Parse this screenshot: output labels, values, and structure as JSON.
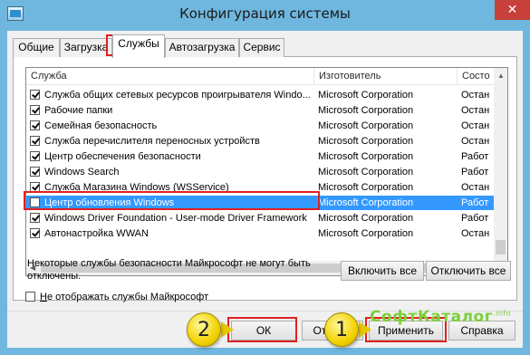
{
  "window": {
    "title": "Конфигурация системы",
    "close_label": "✕"
  },
  "tabs": [
    {
      "label": "Общие"
    },
    {
      "label": "Загрузка"
    },
    {
      "label": "Службы"
    },
    {
      "label": "Автозагрузка"
    },
    {
      "label": "Сервис"
    }
  ],
  "list": {
    "columns": [
      "Служба",
      "Изготовитель",
      "Состо"
    ],
    "rows": [
      {
        "name": "Служба общих сетевых ресурсов проигрывателя Windo...",
        "maker": "Microsoft Corporation",
        "state": "Остан",
        "checked": true
      },
      {
        "name": "Рабочие папки",
        "maker": "Microsoft Corporation",
        "state": "Остан",
        "checked": true
      },
      {
        "name": "Семейная безопасность",
        "maker": "Microsoft Corporation",
        "state": "Остан",
        "checked": true
      },
      {
        "name": "Служба перечислителя переносных устройств",
        "maker": "Microsoft Corporation",
        "state": "Остан",
        "checked": true
      },
      {
        "name": "Центр обеспечения безопасности",
        "maker": "Microsoft Corporation",
        "state": "Работ",
        "checked": true
      },
      {
        "name": "Windows Search",
        "maker": "Microsoft Corporation",
        "state": "Работ",
        "checked": true
      },
      {
        "name": "Служба Магазина Windows (WSService)",
        "maker": "Microsoft Corporation",
        "state": "Остан",
        "checked": true
      },
      {
        "name": "Центр обновления Windows",
        "maker": "Microsoft Corporation",
        "state": "Работ",
        "checked": false,
        "selected": true
      },
      {
        "name": "Windows Driver Foundation - User-mode Driver Framework",
        "maker": "Microsoft Corporation",
        "state": "Работ",
        "checked": true
      },
      {
        "name": "Автонастройка WWAN",
        "maker": "Microsoft Corporation",
        "state": "Остан",
        "checked": true
      }
    ]
  },
  "note": "Некоторые службы безопасности Майкрософт не могут быть отключены.",
  "buttons": {
    "enable_all": "Включить все",
    "disable_all": "Отключить все",
    "ok": "ОК",
    "cancel": "Отмена",
    "apply": "Применить",
    "help": "Справка"
  },
  "hide_ms": {
    "label_first": "Н",
    "label_rest": "е отображать службы Майкрософт",
    "checked": false
  },
  "annotations": {
    "badge_ok": "2",
    "badge_apply": "1",
    "accent": "#e02020"
  },
  "watermark": {
    "text": "СофтКаталог",
    "suffix": ".info"
  }
}
